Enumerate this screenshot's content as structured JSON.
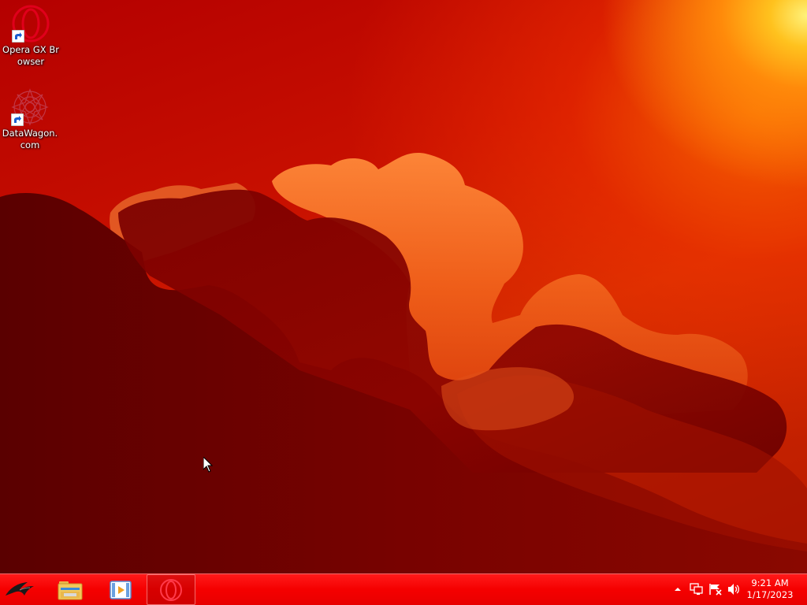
{
  "desktop": {
    "wallpaper": "red-orange-sunset-clouds",
    "icons": [
      {
        "label": "Opera GX Browser",
        "icon": "opera-gx-icon",
        "shortcut": true
      },
      {
        "label": "DataWagon.com",
        "icon": "datawagon-icon",
        "shortcut": true
      }
    ]
  },
  "taskbar": {
    "color": "#f50000",
    "start_icon": "rog-logo-icon",
    "pinned": [
      {
        "name": "File Explorer",
        "icon": "folder-icon"
      },
      {
        "name": "Windows Media Player",
        "icon": "media-player-icon"
      },
      {
        "name": "Opera GX",
        "icon": "opera-gx-icon",
        "active": true
      }
    ],
    "tray": {
      "icons": [
        "show-hidden-icons-arrow",
        "network-icon",
        "action-center-flag-icon",
        "volume-icon"
      ],
      "time": "9:21 AM",
      "date": "1/17/2023"
    }
  },
  "colors": {
    "opera_red": "#e0001b",
    "taskbar_red": "#f50000",
    "sun": "#ffd21e"
  }
}
